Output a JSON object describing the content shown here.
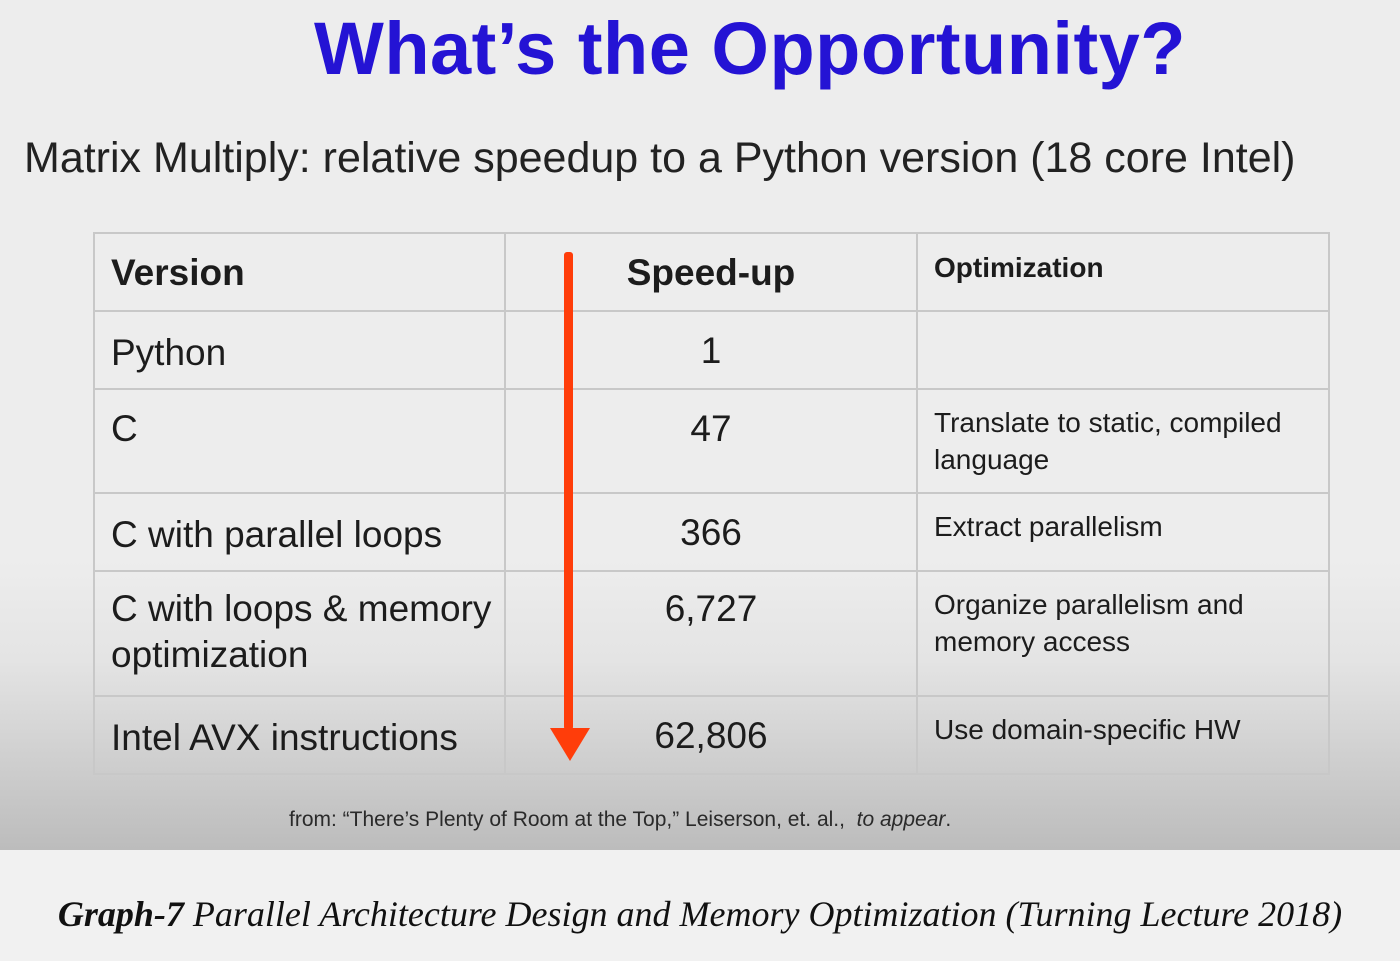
{
  "slide": {
    "title": "What’s the Opportunity?",
    "subtitle": "Matrix Multiply: relative speedup to a Python version (18 core Intel)",
    "title_color": "#2413d4",
    "arrow_color": "#ff3d0a"
  },
  "table": {
    "headers": [
      "Version",
      "Speed-up",
      "Optimization"
    ],
    "rows": [
      {
        "version": "Python",
        "speedup": "1",
        "optimization": ""
      },
      {
        "version": "C",
        "speedup": "47",
        "optimization": "Translate to static, compiled language"
      },
      {
        "version": "C with parallel loops",
        "speedup": "366",
        "optimization": "Extract parallelism"
      },
      {
        "version": "C with loops & memory optimization",
        "speedup": "6,727",
        "optimization": "Organize parallelism and memory access"
      },
      {
        "version": "Intel AVX instructions",
        "speedup": "62,806",
        "optimization": "Use domain-specific HW"
      }
    ]
  },
  "citation": {
    "text": "from: “There’s Plenty of Room at the Top,” Leiserson, et. al.,",
    "emphasis": "to appear",
    "suffix": "."
  },
  "caption": {
    "label": "Graph-7",
    "text": "Parallel Architecture Design and Memory Optimization (Turning Lecture 2018)"
  }
}
